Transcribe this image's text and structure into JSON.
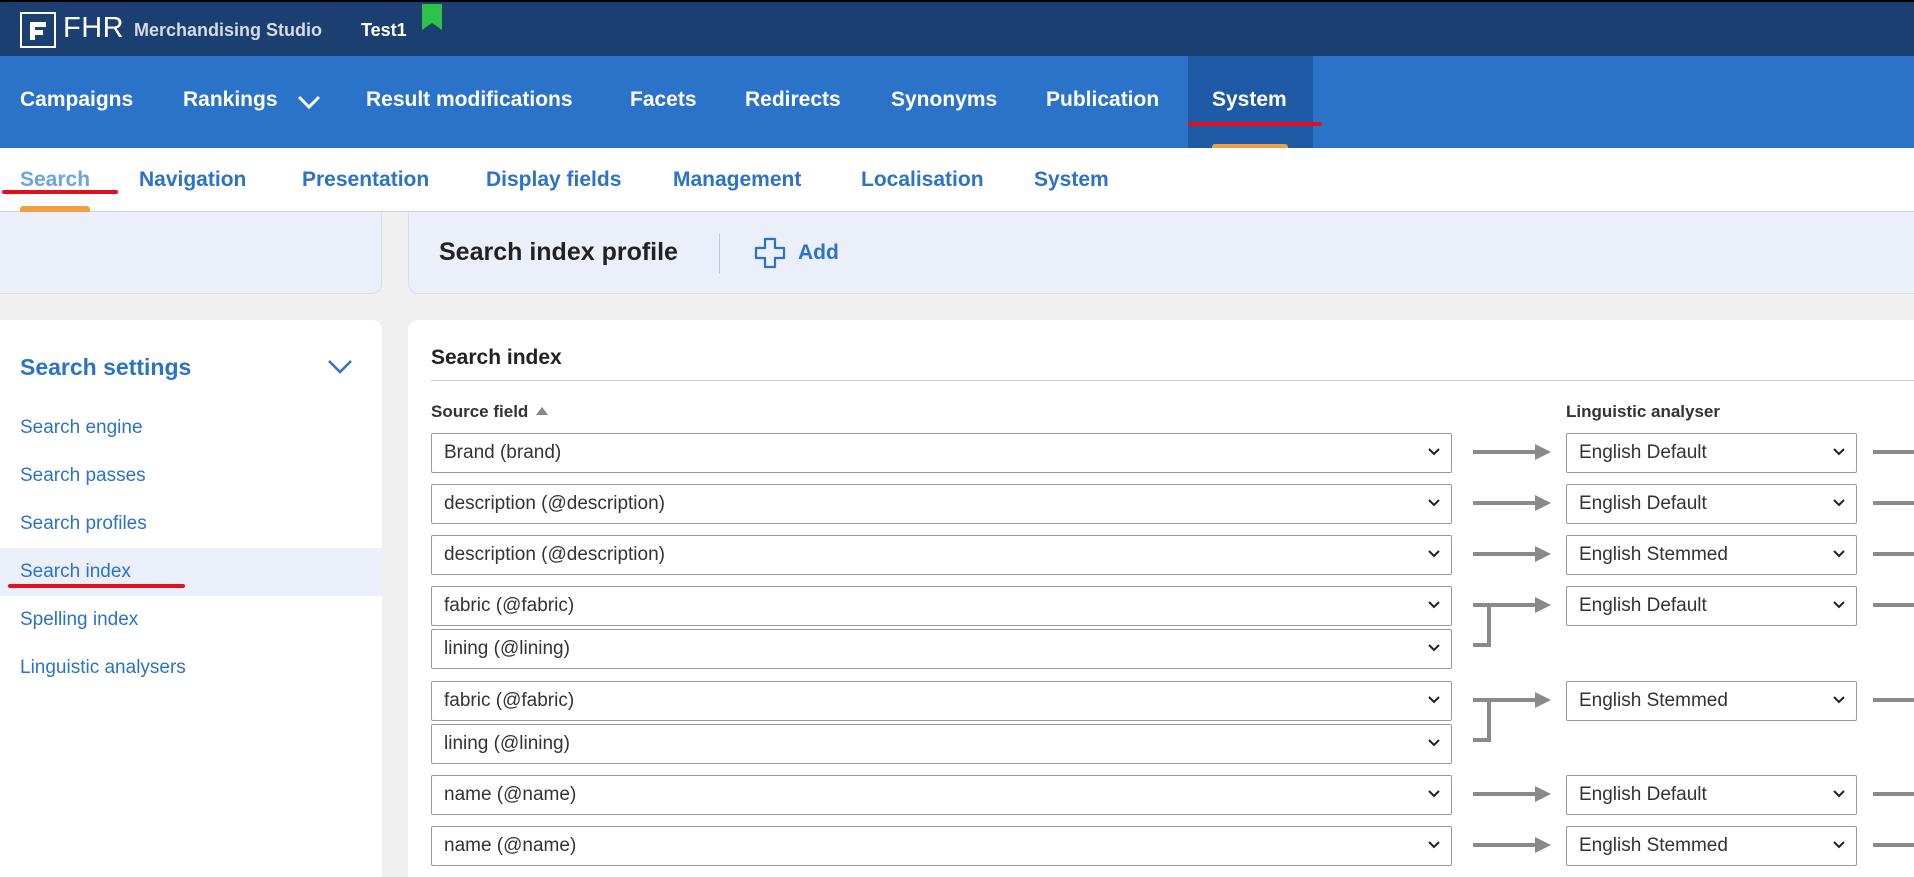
{
  "topbar": {
    "logo_text": "FHR",
    "app_name": "Merchandising Studio",
    "environment": "Test1"
  },
  "main_nav": {
    "items": [
      "Campaigns",
      "Rankings",
      "Result modifications",
      "Facets",
      "Redirects",
      "Synonyms",
      "Publication",
      "System"
    ],
    "active": "System"
  },
  "sub_nav": {
    "items": [
      "Search",
      "Navigation",
      "Presentation",
      "Display fields",
      "Management",
      "Localisation",
      "System"
    ],
    "active": "Search"
  },
  "header": {
    "title": "Search index profile",
    "add_label": "Add"
  },
  "sidebar": {
    "title": "Search settings",
    "items": [
      "Search engine",
      "Search passes",
      "Search profiles",
      "Search index",
      "Spelling index",
      "Linguistic analysers"
    ],
    "active": "Search index"
  },
  "main": {
    "title": "Search index",
    "col_source": "Source field",
    "col_analyser": "Linguistic analyser",
    "rows": [
      {
        "sources": [
          "Brand (brand)"
        ],
        "analyser": "English Default"
      },
      {
        "sources": [
          "description (@description)"
        ],
        "analyser": "English Default"
      },
      {
        "sources": [
          "description (@description)"
        ],
        "analyser": "English Stemmed"
      },
      {
        "sources": [
          "fabric (@fabric)",
          "lining (@lining)"
        ],
        "analyser": "English Default"
      },
      {
        "sources": [
          "fabric (@fabric)",
          "lining (@lining)"
        ],
        "analyser": "English Stemmed"
      },
      {
        "sources": [
          "name (@name)"
        ],
        "analyser": "English Default"
      },
      {
        "sources": [
          "name (@name)"
        ],
        "analyser": "English Stemmed"
      }
    ]
  },
  "colors": {
    "topbar": "#1b3f70",
    "nav": "#2b72c9",
    "accent_orange": "#f0a040",
    "annotation_red": "#e0101e"
  }
}
